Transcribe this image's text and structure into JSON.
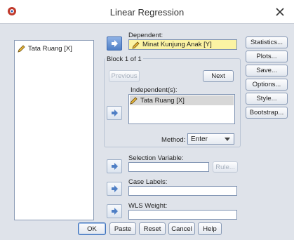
{
  "window": {
    "title": "Linear Regression",
    "app_icon": "spss-icon",
    "close_icon": "close-icon"
  },
  "source_list": {
    "items": [
      {
        "label": "Tata Ruang [X]",
        "icon": "pencil-icon"
      }
    ]
  },
  "dependent": {
    "label": "Dependent:",
    "value": "Minat Kunjung Anak [Y]",
    "icon": "pencil-icon"
  },
  "block": {
    "label": "Block 1 of 1",
    "previous_label": "Previous",
    "next_label": "Next",
    "independents_label": "Independent(s):",
    "independents": [
      {
        "label": "Tata Ruang [X]",
        "icon": "pencil-icon"
      }
    ],
    "method_label": "Method:",
    "method_value": "Enter"
  },
  "selection_variable": {
    "label": "Selection Variable:",
    "value": "",
    "rule_label": "Rule..."
  },
  "case_labels": {
    "label": "Case Labels:",
    "value": ""
  },
  "wls_weight": {
    "label": "WLS Weight:",
    "value": ""
  },
  "side_buttons": [
    "Statistics...",
    "Plots...",
    "Save...",
    "Options...",
    "Style...",
    "Bootstrap..."
  ],
  "bottom_buttons": [
    "OK",
    "Paste",
    "Reset",
    "Cancel",
    "Help"
  ],
  "colors": {
    "dependent_field_bg": "#fbf3a3",
    "selected_bg": "#d7d7d7",
    "arrow_active": "#4f7fc5"
  }
}
